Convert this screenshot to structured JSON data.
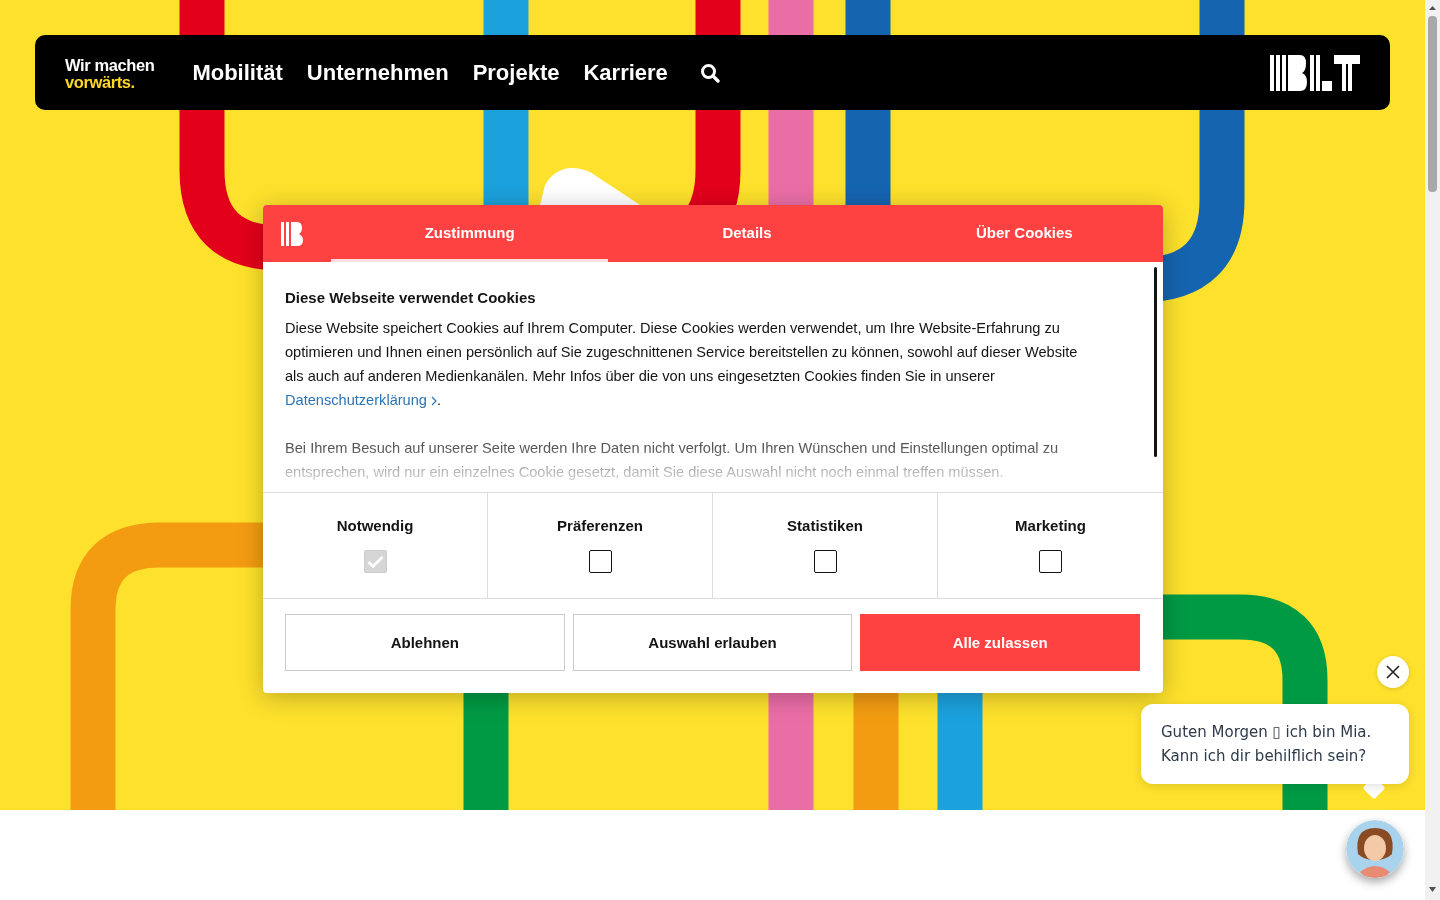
{
  "header": {
    "slogan": [
      "Wir machen",
      "vorwärts."
    ],
    "nav": [
      {
        "label": "Mobilität"
      },
      {
        "label": "Unternehmen"
      },
      {
        "label": "Projekte"
      },
      {
        "label": "Karriere"
      }
    ]
  },
  "cookie_dialog": {
    "tabs": [
      {
        "label": "Zustimmung",
        "selected": true
      },
      {
        "label": "Details",
        "selected": false
      },
      {
        "label": "Über Cookies",
        "selected": false
      }
    ],
    "heading": "Diese Webseite verwendet Cookies",
    "intro": "Diese Website speichert Cookies auf Ihrem Computer. Diese Cookies werden verwendet, um Ihre Website-Erfahrung zu optimieren und Ihnen einen persönlich auf Sie zugeschnittenen Service bereitstellen zu können, sowohl auf dieser Website als auch auf anderen Medienkanälen. Mehr Infos über die von uns eingesetzten Cookies finden Sie in unserer",
    "link": "Datenschutzerklärung",
    "intro_end": ".",
    "note": "Bei Ihrem Besuch auf unserer Seite werden Ihre Daten nicht verfolgt. Um Ihren Wünschen und Einstellungen optimal zu entsprechen, wird nur ein einzelnes Cookie gesetzt, damit Sie diese Auswahl nicht noch einmal treffen müssen.",
    "categories": [
      {
        "label": "Notwendig",
        "checked": true,
        "disabled": true
      },
      {
        "label": "Präferenzen",
        "checked": false,
        "disabled": false
      },
      {
        "label": "Statistiken",
        "checked": false,
        "disabled": false
      },
      {
        "label": "Marketing",
        "checked": false,
        "disabled": false
      }
    ],
    "buttons": [
      {
        "label": "Ablehnen",
        "kind": "outline"
      },
      {
        "label": "Auswahl erlauben",
        "kind": "outline"
      },
      {
        "label": "Alle zulassen",
        "kind": "primary"
      }
    ]
  },
  "chat": {
    "lines": [
      "Guten Morgen ▯ ich bin Mia.",
      "Kann ich dir behilflich sein?"
    ]
  }
}
